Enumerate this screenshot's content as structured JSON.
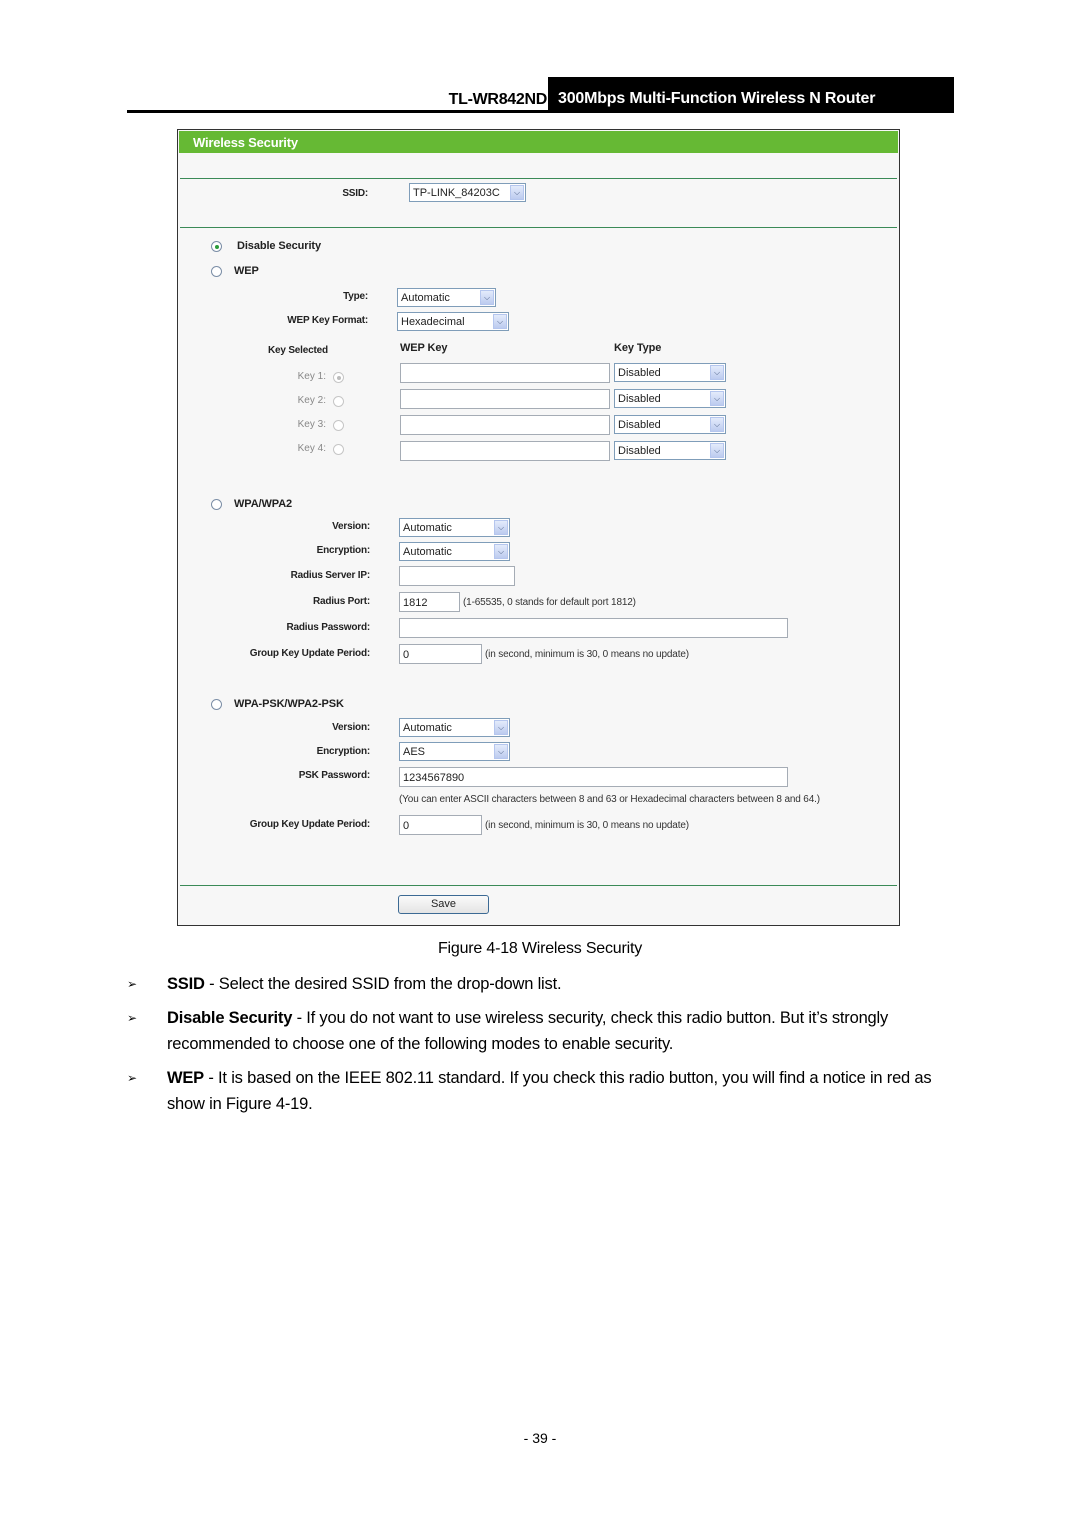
{
  "header": {
    "model": "TL-WR842ND",
    "product": "300Mbps Multi-Function Wireless N Router"
  },
  "panel": {
    "title": "Wireless Security",
    "ssid": {
      "label": "SSID:",
      "value": "TP-LINK_84203C"
    },
    "disable_security": {
      "label": "Disable Security",
      "selected": true
    },
    "wep": {
      "label": "WEP",
      "selected": false,
      "type": {
        "label": "Type:",
        "value": "Automatic"
      },
      "key_format": {
        "label": "WEP Key Format:",
        "value": "Hexadecimal"
      },
      "col_key_selected": "Key Selected",
      "col_wep_key": "WEP Key",
      "col_key_type": "Key Type",
      "keys": [
        {
          "label": "Key 1:",
          "selected": true,
          "value": "",
          "type": "Disabled"
        },
        {
          "label": "Key 2:",
          "selected": false,
          "value": "",
          "type": "Disabled"
        },
        {
          "label": "Key 3:",
          "selected": false,
          "value": "",
          "type": "Disabled"
        },
        {
          "label": "Key 4:",
          "selected": false,
          "value": "",
          "type": "Disabled"
        }
      ]
    },
    "wpa": {
      "label": "WPA/WPA2",
      "selected": false,
      "version": {
        "label": "Version:",
        "value": "Automatic"
      },
      "encryption": {
        "label": "Encryption:",
        "value": "Automatic"
      },
      "radius_ip": {
        "label": "Radius Server IP:",
        "value": ""
      },
      "radius_port": {
        "label": "Radius Port:",
        "value": "1812",
        "hint": "(1-65535, 0 stands for default port 1812)"
      },
      "radius_password": {
        "label": "Radius Password:",
        "value": ""
      },
      "group_key": {
        "label": "Group Key Update Period:",
        "value": "0",
        "hint": "(in second, minimum is 30, 0 means no update)"
      }
    },
    "psk": {
      "label": "WPA-PSK/WPA2-PSK",
      "selected": false,
      "version": {
        "label": "Version:",
        "value": "Automatic"
      },
      "encryption": {
        "label": "Encryption:",
        "value": "AES"
      },
      "password": {
        "label": "PSK Password:",
        "value": "1234567890",
        "hint": "(You can enter ASCII characters between 8 and 63 or Hexadecimal characters between 8 and 64.)"
      },
      "group_key": {
        "label": "Group Key Update Period:",
        "value": "0",
        "hint": "(in second, minimum is 30, 0 means no update)"
      }
    },
    "save_label": "Save"
  },
  "caption": "Figure 4-18 Wireless Security",
  "bullets": [
    {
      "term": "SSID",
      "text": " - Select the desired SSID from the drop-down list."
    },
    {
      "term": "Disable Security",
      "text": " - If you do not want to use wireless security, check this radio button. But it’s strongly recommended to choose one of the following modes to enable security."
    },
    {
      "term": "WEP",
      "text": " - It is based on the IEEE 802.11 standard. If you check this radio button, you will find a notice in red as show in Figure 4-19."
    }
  ],
  "bullet_glyph": "➢",
  "page_number": "- 39 -"
}
